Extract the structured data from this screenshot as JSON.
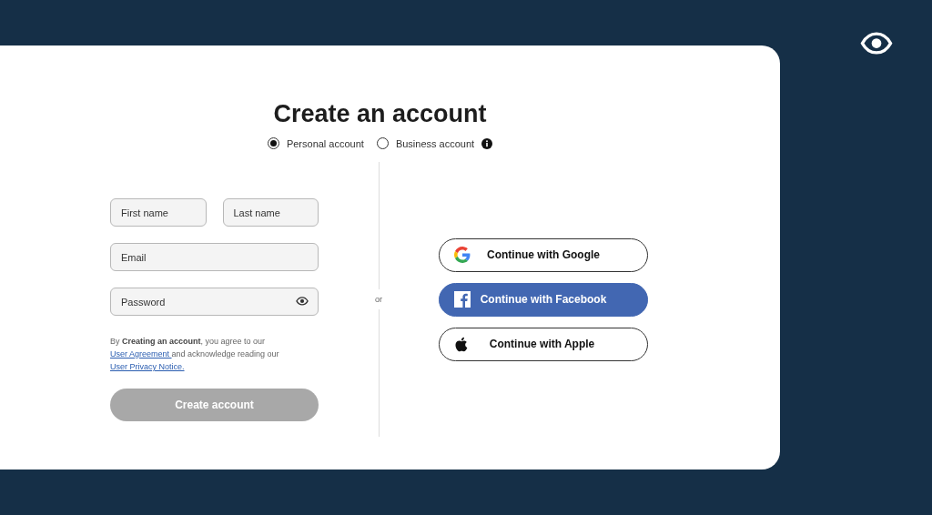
{
  "title": "Create an account",
  "account_types": [
    {
      "label": "Personal account",
      "selected": true,
      "info": false
    },
    {
      "label": "Business account",
      "selected": false,
      "info": true
    }
  ],
  "form": {
    "rows": [
      {
        "fields": [
          {
            "placeholder": "First name",
            "reveal_toggle": false
          },
          {
            "placeholder": "Last name",
            "reveal_toggle": false
          }
        ]
      },
      {
        "fields": [
          {
            "placeholder": "Email",
            "reveal_toggle": false
          }
        ]
      },
      {
        "fields": [
          {
            "placeholder": "Password",
            "reveal_toggle": true
          }
        ]
      }
    ],
    "legal": [
      {
        "kind": "text",
        "text": "By **Creating an account**, you agree to our "
      },
      {
        "kind": "link",
        "text": "User Agreement "
      },
      {
        "kind": "text",
        "text": "and acknowledge reading our "
      },
      {
        "kind": "link",
        "text": "User Privacy Notice."
      }
    ],
    "submit": {
      "label": "Create account",
      "disabled": true
    }
  },
  "separator": "or",
  "providers": [
    {
      "kind": "google",
      "label": "Continue with Google"
    },
    {
      "kind": "facebook",
      "label": "Continue with Facebook"
    },
    {
      "kind": "apple",
      "label": "Continue with Apple"
    }
  ]
}
